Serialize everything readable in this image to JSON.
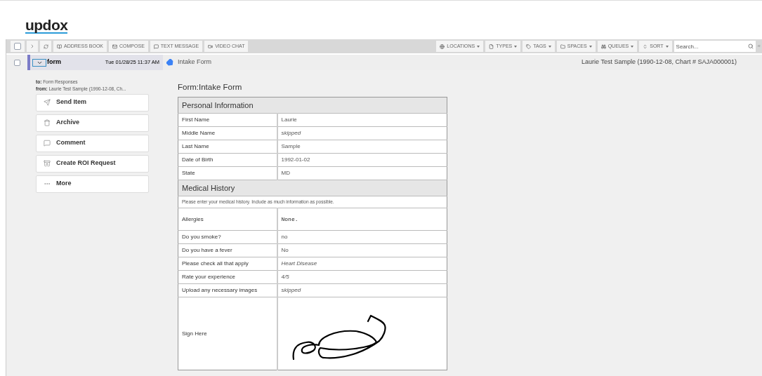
{
  "logo": "updox",
  "toolbar": {
    "select_all_checked": false,
    "left": [
      {
        "label": "ADDRESS BOOK"
      },
      {
        "label": "COMPOSE"
      },
      {
        "label": "TEXT MESSAGE"
      },
      {
        "label": "VIDEO CHAT"
      }
    ],
    "right": [
      {
        "label": "LOCATIONS"
      },
      {
        "label": "TYPES"
      },
      {
        "label": "TAGS"
      },
      {
        "label": "SPACES"
      },
      {
        "label": "QUEUES"
      },
      {
        "label": "SORT"
      }
    ],
    "search": {
      "placeholder": "Search..."
    },
    "collapse": "«"
  },
  "message": {
    "checked": false,
    "expanded": true,
    "type": "form",
    "date": "Tue 01/28/25 11:37 AM",
    "subject": "Intake Form",
    "patient": "Laurie Test Sample (1990-12-08, Chart # SAJA000001)"
  },
  "details": {
    "to_label": "to:",
    "to": "Form Responses",
    "from_label": "from:",
    "from": "Laurie Test Sample (1990-12-08, Ch..."
  },
  "actions": [
    {
      "label": "Send Item"
    },
    {
      "label": "Archive"
    },
    {
      "label": "Comment"
    },
    {
      "label": "Create ROI Request"
    },
    {
      "label": "More"
    }
  ],
  "form": {
    "title": "Form:Intake Form",
    "rows": [
      {
        "kind": "section",
        "label": "Personal Information"
      },
      {
        "kind": "field",
        "label": "First Name",
        "value": "Laurie"
      },
      {
        "kind": "selection",
        "label": "Middle Name",
        "value": "skipped"
      },
      {
        "kind": "field",
        "label": "Last Name",
        "value": "Sample"
      },
      {
        "kind": "field",
        "label": "Date of Birth",
        "value": "1992-01-02"
      },
      {
        "kind": "field",
        "label": "State",
        "value": "MD"
      },
      {
        "kind": "section",
        "label": "Medical History"
      },
      {
        "kind": "note",
        "label": "Please enter your medical history. Include as much information as possible."
      },
      {
        "kind": "freetext",
        "label": "Allergies",
        "value": "None."
      },
      {
        "kind": "field",
        "label": "Do you smoke?",
        "value": "no"
      },
      {
        "kind": "field",
        "label": "Do you have a fever",
        "value": "No"
      },
      {
        "kind": "selection",
        "label": "Please check all that apply",
        "value": "Heart Disease"
      },
      {
        "kind": "selection",
        "label": "Rate your experience",
        "value": "4/5"
      },
      {
        "kind": "selection",
        "label": "Upload any necessary images",
        "value": "skipped"
      },
      {
        "kind": "signature",
        "label": "Sign Here"
      }
    ]
  }
}
